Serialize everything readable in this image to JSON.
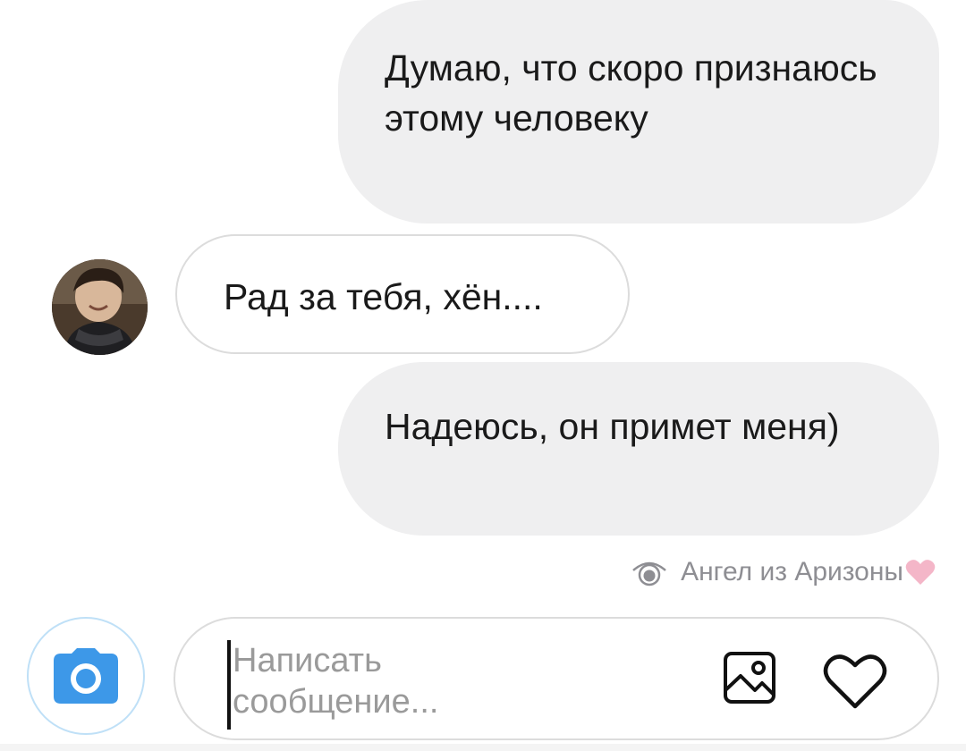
{
  "messages": [
    {
      "direction": "outgoing",
      "text": "Думаю, что скоро признаюсь этому человеку"
    },
    {
      "direction": "incoming",
      "text": "Рад за тебя, хён...."
    },
    {
      "direction": "outgoing",
      "text": "Надеюсь, он примет меня)"
    }
  ],
  "seen": {
    "icon": "eye-icon",
    "by": "Ангел из Аризоны",
    "heart_icon": "heart-emoji",
    "heart_color": "#f4b6c8"
  },
  "composer": {
    "placeholder": "Написать сообщение...",
    "camera_icon": "camera-icon",
    "camera_color": "#3d98e8",
    "gallery_icon": "gallery-icon",
    "like_icon": "heart-outline-icon"
  },
  "avatar": {
    "icon": "user-avatar"
  }
}
